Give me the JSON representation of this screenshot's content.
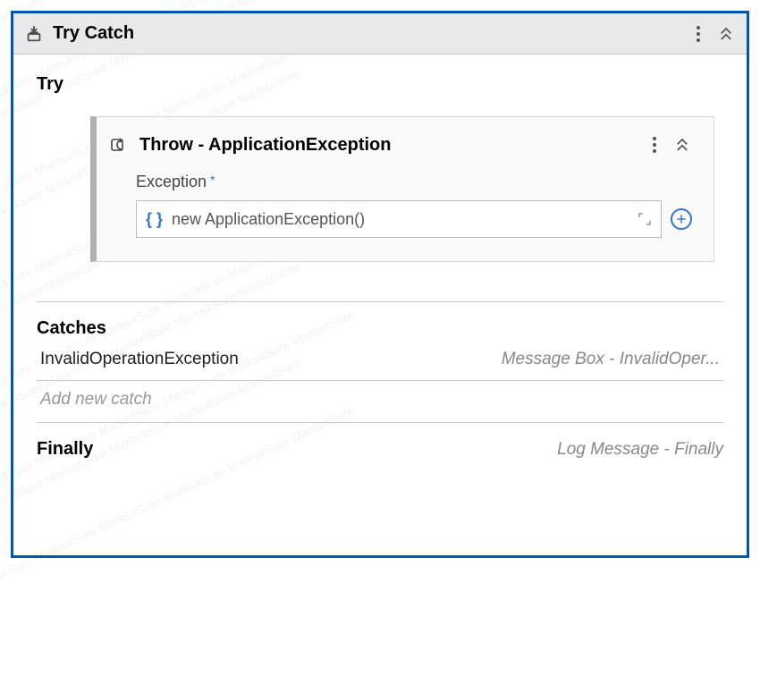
{
  "titlebar": {
    "title": "Try Catch"
  },
  "try": {
    "section_label": "Try",
    "activity_title": "Throw - ApplicationException",
    "field_label": "Exception",
    "expression": "new ApplicationException()"
  },
  "catches": {
    "label": "Catches",
    "items": [
      {
        "exception": "InvalidOperationException",
        "handler": "Message Box - InvalidOper..."
      }
    ],
    "add_placeholder": "Add new catch"
  },
  "finally": {
    "label": "Finally",
    "handler": "Log Message - Finally"
  },
  "watermark_text": "Marks4Sure"
}
